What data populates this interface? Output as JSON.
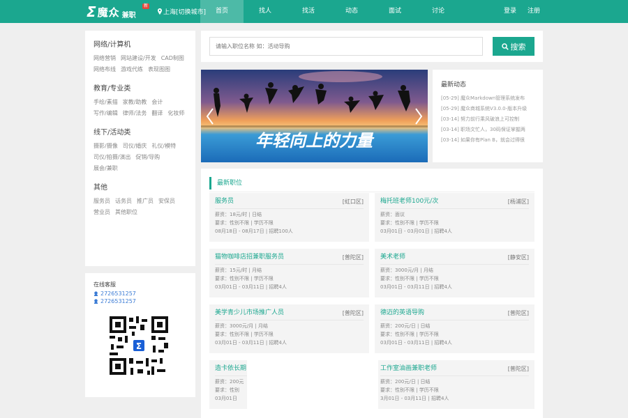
{
  "header": {
    "logo_mark": "Σ",
    "logo_text": "魔众",
    "logo_sub": "兼职",
    "logo_badge": "新",
    "location": "上海[切换城市]",
    "nav": [
      "首页",
      "找人",
      "找活",
      "动态",
      "面试",
      "讨论"
    ],
    "nav_active": 0,
    "login": "登录",
    "register": "注册",
    "brand_color": "#1ba78f"
  },
  "categories": [
    {
      "title": "网络/计算机",
      "items": [
        "网络营销",
        "网站建设/开发",
        "CAD制图",
        "网络布线",
        "游戏代练",
        "表现图图"
      ]
    },
    {
      "title": "教育/专业类",
      "items": [
        "手绘/素描",
        "家教/助教",
        "会计",
        "写作/编辑",
        "律师/法务",
        "翻译",
        "化妆师"
      ]
    },
    {
      "title": "线下/活动类",
      "items": [
        "摄影/摄像",
        "司仪/婚庆",
        "礼仪/模特",
        "司仪/拍摄/演出",
        "促销/导购",
        "展会/兼职"
      ]
    },
    {
      "title": "其他",
      "items": [
        "服务员",
        "话务员",
        "推广员",
        "安保员",
        "营业员",
        "其他职位"
      ]
    }
  ],
  "service": {
    "title": "在线客服",
    "qq": [
      "2726531257",
      "2726531257"
    ]
  },
  "search": {
    "placeholder": "请输入职位名称 如：活动导购",
    "button": "搜索"
  },
  "banner": {
    "slogan": "年轻向上的力量"
  },
  "news": {
    "title": "最新动态",
    "items": [
      "[05-29] 魔众Markdown管理系统发布",
      "[05-29] 魔众商城系统V3.0.0-版本升级",
      "[03-14] 努力前行乘风破浪上可控制",
      "[03-14] 职场文忙人，30码保证掌握两",
      "[03-14] 如果你有Plan B，就会过得很"
    ]
  },
  "jobs": {
    "heading": "最新职位",
    "list": [
      {
        "title": "服务员",
        "area": "[虹口区]",
        "salary": "薪资：18元/时 | 日结",
        "req": "要求：性别不限 | 学历不限",
        "time": "08月18日 - 08月17日 | 招聘100人"
      },
      {
        "title": "梅托班老师100元/次",
        "area": "[杨浦区]",
        "salary": "薪资：面议",
        "req": "要求：性别不限 | 学历不限",
        "time": "03月01日 - 03月01日 | 招聘4人"
      },
      {
        "title": "猫物咖啡店招兼职服务员",
        "area": "[普陀区]",
        "salary": "薪资：15元/时 | 月结",
        "req": "要求：性别不限 | 学历不限",
        "time": "03月01日 - 03月11日 | 招聘4人"
      },
      {
        "title": "美术老师",
        "area": "[静安区]",
        "salary": "薪资：3000元/月 | 月结",
        "req": "要求：性别不限 | 学历不限",
        "time": "03月01日 - 03月11日 | 招聘4人"
      },
      {
        "title": "美学青少儿市场推广人员",
        "area": "[普陀区]",
        "salary": "薪资：3000元/月 | 月结",
        "req": "要求：性别不限 | 学历不限",
        "time": "03月01日 - 03月11日 | 招聘4人"
      },
      {
        "title": "德迈的英语导购",
        "area": "[普陀区]",
        "salary": "薪资：200元/日 | 日结",
        "req": "要求：性别不限 | 学历不限",
        "time": "03月01日 - 03月11日 | 招聘4人"
      },
      {
        "title": "造卡依长期",
        "area": "",
        "salary": "薪资：200元",
        "req": "要求：性别",
        "time": "03月01日"
      },
      {
        "title": "工作室油画兼职老师",
        "area": "[普陀区]",
        "salary": "薪资：200元/日 | 日结",
        "req": "要求：性别不限 | 学历不限",
        "time": "3月01日 - 03月11日 | 招聘4人"
      }
    ]
  }
}
